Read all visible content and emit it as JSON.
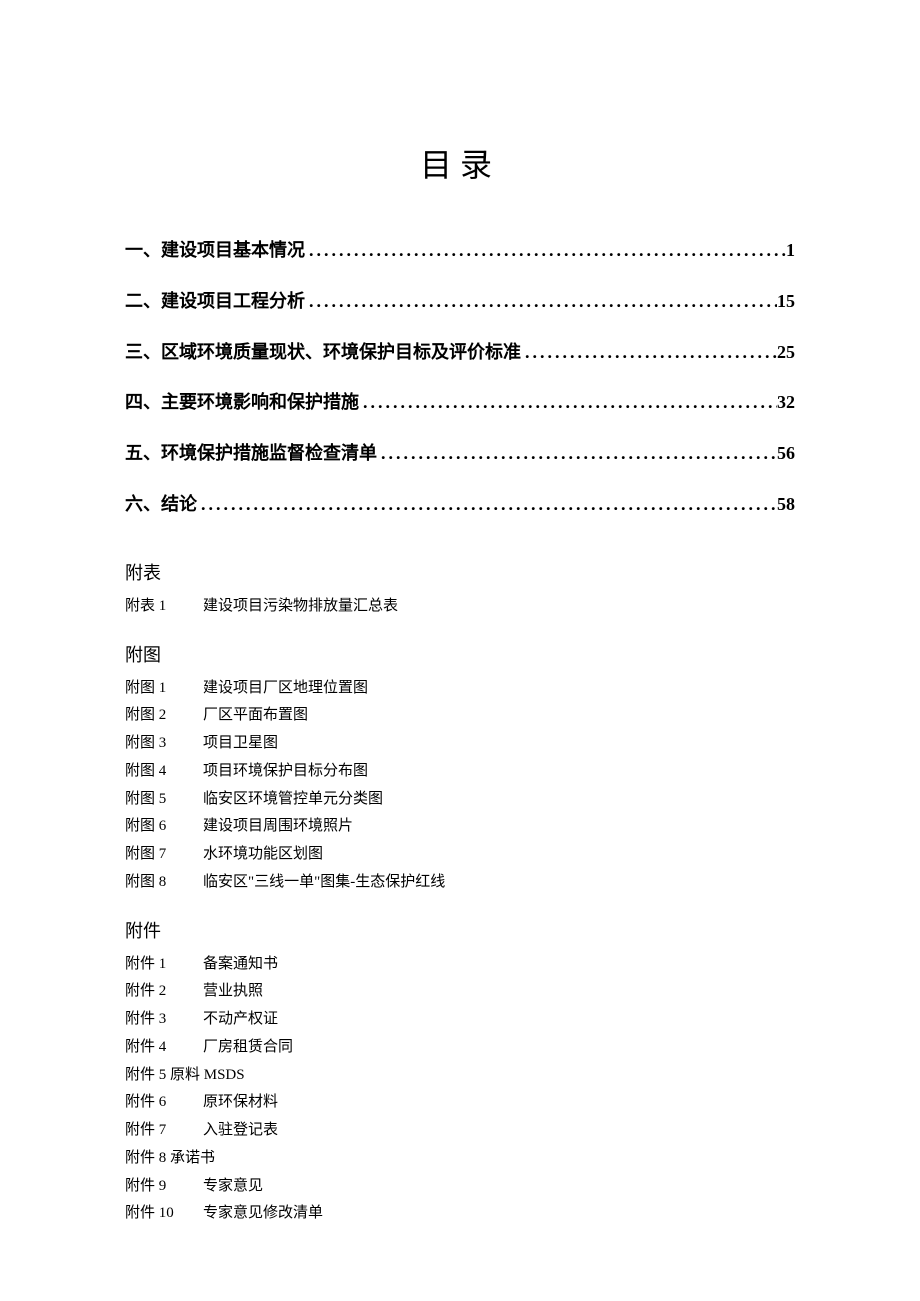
{
  "title": "目录",
  "toc": [
    {
      "label": "一、建设项目基本情况",
      "page": "1"
    },
    {
      "label": "二、建设项目工程分析",
      "page": "15"
    },
    {
      "label": "三、区域环境质量现状、环境保护目标及评价标准",
      "page": "25"
    },
    {
      "label": "四、主要环境影响和保护措施",
      "page": "32"
    },
    {
      "label": "五、环境保护措施监督检查清单",
      "page": "56"
    },
    {
      "label": "六、结论",
      "page": "58"
    }
  ],
  "sections": {
    "fubiao": {
      "heading": "附表",
      "items": [
        {
          "key": "附表 1",
          "val": "建设项目污染物排放量汇总表"
        }
      ]
    },
    "futu": {
      "heading": "附图",
      "items": [
        {
          "key": "附图 1",
          "val": "建设项目厂区地理位置图"
        },
        {
          "key": "附图 2",
          "val": "厂区平面布置图"
        },
        {
          "key": "附图 3",
          "val": "项目卫星图"
        },
        {
          "key": "附图 4",
          "val": "项目环境保护目标分布图"
        },
        {
          "key": "附图 5",
          "val": "临安区环境管控单元分类图"
        },
        {
          "key": "附图 6",
          "val": "建设项目周围环境照片"
        },
        {
          "key": "附图 7",
          "val": "水环境功能区划图"
        },
        {
          "key": "附图 8",
          "val": "临安区\"三线一单\"图集-生态保护红线"
        }
      ]
    },
    "fujian": {
      "heading": "附件",
      "items": [
        {
          "key": "附件 1",
          "val": "备案通知书"
        },
        {
          "key": "附件 2",
          "val": "营业执照"
        },
        {
          "key": "附件 3",
          "val": "不动产权证"
        },
        {
          "key": "附件 4",
          "val": "厂房租赁合同"
        },
        {
          "inline": "附件 5 原料 MSDS"
        },
        {
          "key": "附件 6",
          "val": "原环保材料"
        },
        {
          "key": "附件 7",
          "val": "入驻登记表"
        },
        {
          "inline": "附件 8 承诺书"
        },
        {
          "key": "附件 9",
          "val": "专家意见"
        },
        {
          "key": "附件 10",
          "val": "专家意见修改清单"
        }
      ]
    }
  }
}
